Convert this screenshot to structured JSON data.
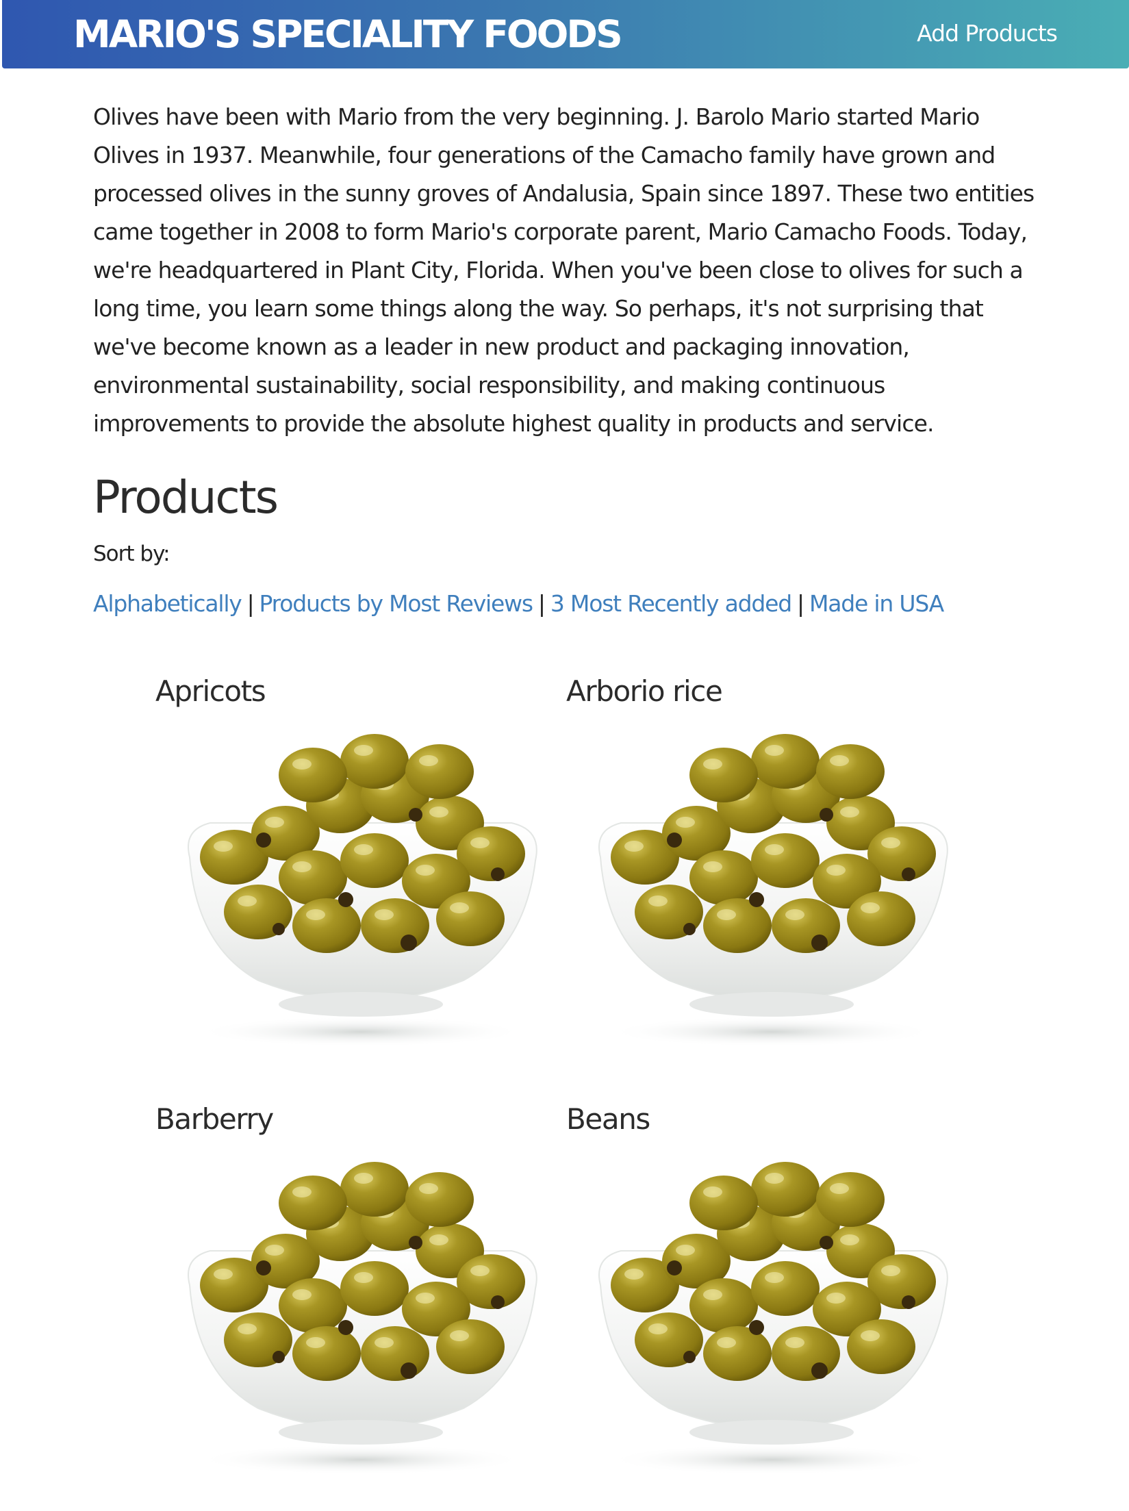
{
  "header": {
    "brand": "MARIO'S SPECIALITY FOODS",
    "add_products": "Add Products"
  },
  "intro_text": "Olives have been with Mario from the very beginning. J. Barolo Mario started Mario Olives in 1937. Meanwhile, four generations of the Camacho family have grown and processed olives in the sunny groves of Andalusia, Spain since 1897. These two entities came together in 2008 to form Mario's corporate parent, Mario Camacho Foods. Today, we're headquartered in Plant City, Florida. When you've been close to olives for such a long time, you learn some things along the way. So perhaps, it's not surprising that we've become known as a leader in new product and packaging innovation, environmental sustainability, social responsibility, and making continuous improvements to provide the absolute highest quality in products and service.",
  "products_section": {
    "title": "Products",
    "sort_label": "Sort by:",
    "sort_links": [
      "Alphabetically",
      "Products by Most Reviews",
      "3 Most Recently added",
      "Made in USA"
    ],
    "separator": "|"
  },
  "products": [
    {
      "name": "Apricots",
      "image": "olive-bowl-image"
    },
    {
      "name": "Arborio rice",
      "image": "olive-bowl-image"
    },
    {
      "name": "Barberry",
      "image": "olive-bowl-image"
    },
    {
      "name": "Beans",
      "image": "olive-bowl-image"
    }
  ],
  "colors": {
    "header_start": "#2f57b0",
    "header_end": "#4aaeb5",
    "link": "#3f7fbd",
    "olive": "#9a8a1c",
    "bowl": "#f2f3f2"
  }
}
